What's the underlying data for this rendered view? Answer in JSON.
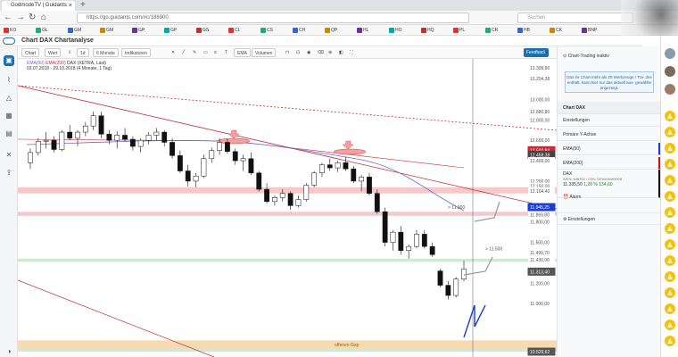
{
  "browser": {
    "tab_title": "GodmodeTV | Guidants",
    "url": "https://go.guidants.com/#c/186900",
    "search_placeholder": "Suchen"
  },
  "bookmarks": [
    "KO",
    "GL",
    "GM",
    "GM",
    "GP",
    "GP",
    "GS",
    "CL",
    "CS",
    "CH",
    "QP",
    "HL",
    "HO",
    "HQ",
    "PL",
    "CR",
    "HB",
    "CK",
    "BNP"
  ],
  "app": {
    "title": "Chart DAX Chartanalyse"
  },
  "toolbar": {
    "chart": "Chart",
    "wert": "Wert",
    "interval": "1d",
    "period": "6 Monate",
    "indicators": "Indikatoren",
    "ema": "EMA",
    "volume": "Volumen",
    "feedback": "Feedback"
  },
  "legend": {
    "ema50": "EMA(50)",
    "ema200": "EMA(200)",
    "instrument": "DAX (XETRA, Last)",
    "range": "03.07.2018 - 29.10.2018",
    "period": "(4 Monate, 1 Tag)"
  },
  "right_panel": {
    "header": "Chart-Trading inaktiv",
    "note": "Das ihr Chart mehr als 20 Werkzeuge / Tra- des enthält, kann hier nur das aktuell aus- gewählte angezeigt.",
    "section": "Chart DAX",
    "items": [
      "Einstellungen",
      "Primäre Y-Achse",
      "EMA(50)",
      "EMA(200)"
    ],
    "instrument_name": "DAX",
    "wkn": "WKN: 846900 / ISIN: DE0008469008",
    "quote": "11.335,50",
    "change": "1,20 %",
    "change_abs": "134,60",
    "alarm": "Alarm",
    "settings": "Einstellungen"
  },
  "y_axis_labels": [
    "13.309,90",
    "13.204,38",
    "13.000,00",
    "12.880,80",
    "12.800,00",
    "12.600,00",
    "12.502,84",
    "12.458,38",
    "12.400,00",
    "12.200,00",
    "12.150,00",
    "12.104,40",
    "11.945,25",
    "11.869,80",
    "11.800,00",
    "11.600,00",
    "11.499,70",
    "11.430,90",
    "11.313,40",
    "11.200,00",
    "11.000,00",
    "10.529,62"
  ],
  "annotations": {
    "target1": "> 11.900",
    "target2": "> 11.500",
    "gap": "offenen Gap"
  },
  "colors": {
    "up": "#ffffff",
    "down": "#111111",
    "ema50": "#6b6bd6",
    "ema200": "#c0303a",
    "accent": "#1a6fb5"
  },
  "chart_data": {
    "type": "candlestick",
    "title": "DAX (XETRA, Last)",
    "y_range": [
      10529.62,
      13309.9
    ],
    "candles": [
      [
        12380,
        12520,
        12320,
        12480
      ],
      [
        12480,
        12620,
        12450,
        12590
      ],
      [
        12590,
        12680,
        12520,
        12600
      ],
      [
        12600,
        12640,
        12480,
        12510
      ],
      [
        12510,
        12700,
        12490,
        12680
      ],
      [
        12680,
        12750,
        12600,
        12620
      ],
      [
        12620,
        12700,
        12540,
        12680
      ],
      [
        12680,
        12780,
        12640,
        12740
      ],
      [
        12740,
        12880,
        12700,
        12840
      ],
      [
        12840,
        12880,
        12620,
        12660
      ],
      [
        12660,
        12700,
        12560,
        12600
      ],
      [
        12600,
        12690,
        12520,
        12650
      ],
      [
        12650,
        12720,
        12590,
        12610
      ],
      [
        12610,
        12640,
        12500,
        12540
      ],
      [
        12540,
        12620,
        12480,
        12600
      ],
      [
        12600,
        12680,
        12560,
        12650
      ],
      [
        12650,
        12720,
        12600,
        12680
      ],
      [
        12680,
        12700,
        12540,
        12580
      ],
      [
        12580,
        12620,
        12420,
        12450
      ],
      [
        12450,
        12500,
        12280,
        12300
      ],
      [
        12300,
        12360,
        12150,
        12200
      ],
      [
        12200,
        12280,
        12140,
        12250
      ],
      [
        12250,
        12460,
        12230,
        12420
      ],
      [
        12420,
        12530,
        12380,
        12500
      ],
      [
        12500,
        12620,
        12460,
        12580
      ],
      [
        12580,
        12610,
        12470,
        12490
      ],
      [
        12490,
        12520,
        12360,
        12400
      ],
      [
        12400,
        12460,
        12300,
        12420
      ],
      [
        12420,
        12480,
        12260,
        12280
      ],
      [
        12280,
        12300,
        12100,
        12120
      ],
      [
        12120,
        12180,
        11980,
        12000
      ],
      [
        12000,
        12060,
        11960,
        12040
      ],
      [
        12040,
        12120,
        12000,
        12080
      ],
      [
        12080,
        12100,
        11920,
        11960
      ],
      [
        11960,
        12060,
        11940,
        12020
      ],
      [
        12020,
        12180,
        12000,
        12160
      ],
      [
        12160,
        12300,
        12140,
        12280
      ],
      [
        12280,
        12380,
        12240,
        12360
      ],
      [
        12360,
        12420,
        12300,
        12330
      ],
      [
        12330,
        12400,
        12290,
        12380
      ],
      [
        12380,
        12440,
        12300,
        12320
      ],
      [
        12320,
        12350,
        12180,
        12200
      ],
      [
        12200,
        12260,
        12100,
        12240
      ],
      [
        12240,
        12280,
        12060,
        12080
      ],
      [
        12080,
        12120,
        11880,
        11900
      ],
      [
        11900,
        11940,
        11560,
        11600
      ],
      [
        11600,
        11720,
        11520,
        11700
      ],
      [
        11700,
        11760,
        11480,
        11520
      ],
      [
        11520,
        11580,
        11440,
        11560
      ],
      [
        11560,
        11720,
        11540,
        11680
      ],
      [
        11680,
        11720,
        11540,
        11560
      ],
      [
        11560,
        11600,
        11460,
        11480
      ],
      [
        11320,
        11340,
        11160,
        11180
      ],
      [
        11180,
        11220,
        11040,
        11080
      ],
      [
        11080,
        11260,
        11060,
        11240
      ],
      [
        11240,
        11420,
        11220,
        11340
      ]
    ]
  }
}
